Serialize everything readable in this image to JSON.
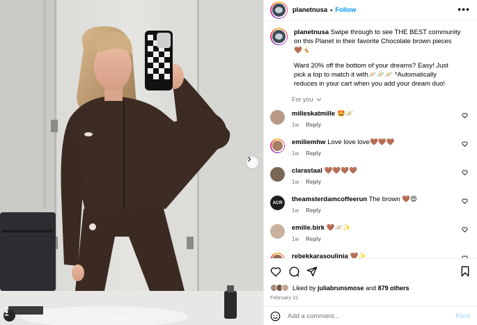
{
  "header": {
    "username": "planetnusa",
    "separator": "•",
    "follow_label": "Follow",
    "more_label": "•••"
  },
  "caption": {
    "username": "planetnusa",
    "line1": "Swipe through to see THE BEST community on this Planet in their favorite Chocolate brown pieces 🤎🤸",
    "line2": "Want 20% off the bottom of your dreams? Easy! Just pick a top to match it with🪐🪐🪐 *Automatically reduces in your cart when you add your dream duo!"
  },
  "filter": {
    "label": "For you"
  },
  "comments": [
    {
      "username": "milleskatmille",
      "text": "🤩🪐",
      "time": "1w",
      "reply": "Reply",
      "avatar_color": "#b89a86",
      "ring": false
    },
    {
      "username": "emiliemhw",
      "text": "Love love love🤎🤎🤎",
      "time": "1w",
      "reply": "Reply",
      "avatar_color": "#a57d62",
      "ring": true
    },
    {
      "username": "clarastaal",
      "text": "🤎🤎🤎🤎",
      "time": "1w",
      "reply": "Reply",
      "avatar_color": "#7a6756",
      "ring": false
    },
    {
      "username": "theamsterdamcoffeerun",
      "text": "The brown 🤎😍",
      "time": "1w",
      "reply": "Reply",
      "avatar_color": "#1e1e1e",
      "avatar_text": "ACR",
      "ring": false
    },
    {
      "username": "emilie.birk",
      "text": "🤎🪐✨",
      "time": "1w",
      "reply": "Reply",
      "avatar_color": "#c9b19e",
      "ring": false
    },
    {
      "username": "rebekkarasoulinia",
      "text": "🤎✨",
      "time": "1w",
      "reply": "Reply",
      "avatar_color": "#8d6a55",
      "ring": true
    }
  ],
  "likes": {
    "prefix": "Liked by",
    "user": "juliabrunsmose",
    "and": "and",
    "others": "879 others"
  },
  "date": "February 22",
  "add_comment": {
    "placeholder": "Add a comment...",
    "post_label": "Post"
  },
  "carousel": {
    "slides": 6,
    "active": 0
  },
  "colors": {
    "accent": "#0095f6",
    "muted": "#737373",
    "post_disabled": "#b3dbff",
    "divider": "#efefef"
  },
  "icons": [
    "heart-icon",
    "comment-icon",
    "share-icon",
    "bookmark-icon",
    "emoji-icon",
    "more-icon",
    "chevron-down-icon",
    "chevron-right-icon",
    "user-tag-icon"
  ]
}
